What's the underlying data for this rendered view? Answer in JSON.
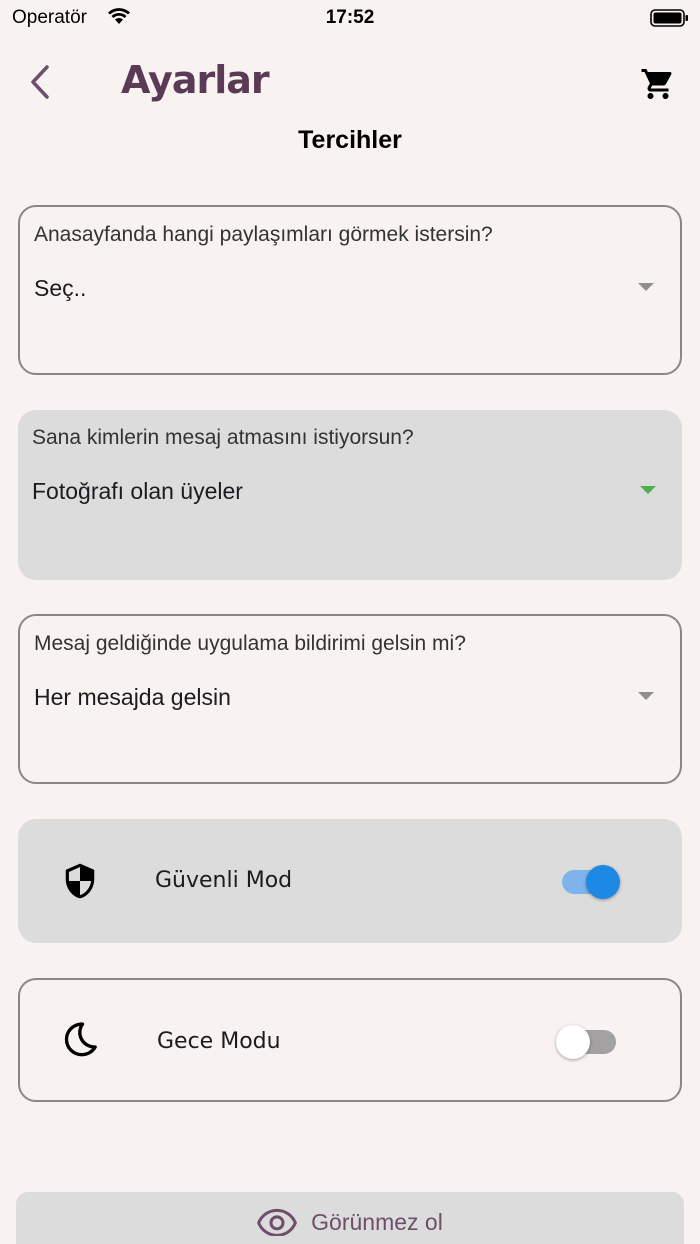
{
  "status_bar": {
    "carrier": "Operatör",
    "time": "17:52",
    "icons": [
      "wifi-icon",
      "battery-icon"
    ]
  },
  "header": {
    "title": "Ayarlar",
    "back_icon": "chevron-left-icon",
    "cart_icon": "shopping-cart-icon",
    "title_color": "#5a3a55"
  },
  "section": {
    "title": "Tercihler"
  },
  "preferences": [
    {
      "label": "Anasayfanda hangi paylaşımları görmek istersin?",
      "value": "Seç..",
      "style": "outlined"
    },
    {
      "label": "Sana kimlerin mesaj atmasını istiyorsun?",
      "value": "Fotoğrafı olan üyeler",
      "style": "filled",
      "arrow_color": "#4caf50"
    },
    {
      "label": "Mesaj geldiğinde uygulama bildirimi gelsin mi?",
      "value": "Her mesajda gelsin",
      "style": "outlined"
    }
  ],
  "toggles": [
    {
      "label": "Güvenli Mod",
      "icon": "shield-icon",
      "checked": true
    },
    {
      "label": "Gece Modu",
      "icon": "moon-icon",
      "checked": false
    }
  ],
  "bottom_button": {
    "label": "Görünmez ol",
    "icon": "eye-icon"
  },
  "colors": {
    "background": "#f8f2f1",
    "accent": "#1e88e5",
    "card_filled": "#dddcdc",
    "brand": "#6e4f6a"
  }
}
